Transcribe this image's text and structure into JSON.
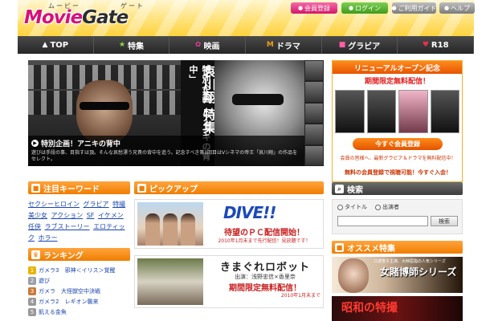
{
  "header": {
    "logo_main": "Movie",
    "logo_gate": "Gate",
    "logo_ruby1": "ムービー",
    "logo_ruby2": "ゲート",
    "buttons": {
      "register": "会員登録",
      "login": "ログイン",
      "guide": "ご利用ガイド",
      "help": "ヘルプ"
    }
  },
  "nav": {
    "items": [
      {
        "icon": "home-icon",
        "label": "TOP"
      },
      {
        "icon": "star-icon",
        "label": "特集"
      },
      {
        "icon": "film-icon",
        "label": "映画"
      },
      {
        "icon": "m-icon",
        "label": "ドラマ"
      },
      {
        "icon": "camera-icon",
        "label": "グラビア"
      },
      {
        "icon": "r18-icon",
        "label": "R18"
      }
    ]
  },
  "hero": {
    "vertical_title": "特別企画「アニキの背中」",
    "vertical_name": "哀川翔 特集",
    "caption_title": "特別企画！アニキの背中",
    "caption_desc": "遊びは手段の事、目指すは頂。そんな哀愁漂う兄貴の背中を追う。記念すべき第1回目はVシネマの帝王「哀川翔」の作品をセレクト。"
  },
  "promo": {
    "head1": "リニューアルオープン記念",
    "head2": "期間限定無料配信！",
    "button": "今すぐ会員登録",
    "note": "会員の皆様へ、最新グラビア＆ドラマを無料配信中！",
    "note2": "無料の会員登録で視聴可能！今すぐ入会！"
  },
  "keywords": {
    "title": "注目キーワード",
    "items": [
      "セクシーヒロイン",
      "グラビア",
      "特撮",
      "美少女",
      "アクション",
      "SF",
      "イケメン",
      "任侠",
      "ラブストーリー",
      "エロティック",
      "ホラー"
    ]
  },
  "ranking": {
    "title": "ランキング",
    "items": [
      {
        "n": "1",
        "label": "ガメラ3　邪神＜イリス＞覚醒"
      },
      {
        "n": "2",
        "label": "遊び"
      },
      {
        "n": "3",
        "label": "ガメラ　大怪獣空中決戦"
      },
      {
        "n": "4",
        "label": "ガメラ2　レギオン襲来"
      },
      {
        "n": "5",
        "label": "飢える金魚"
      }
    ]
  },
  "pickup": {
    "title": "ピックアップ",
    "item1": {
      "logo": "DIVE!!",
      "headline": "待望のＰＣ配信開始！",
      "sub": "2010年1月末まで先行配信！見放題です！"
    },
    "item2": {
      "title": "きまぐれロボット",
      "cast": "出演：浅野忠信×香里奈",
      "headline": "期間限定無料配信！",
      "until": "2010年1月末まで"
    }
  },
  "search": {
    "title": "検索",
    "option1": "タイトル",
    "option2": "出演者",
    "placeholder": "",
    "button": "検索"
  },
  "osusume": {
    "title": "オススメ特集",
    "item1_title": "女賭博師シリーズ",
    "item1_sub": "江波杏子主演、大映屈指の人気シリーズ",
    "item2_title": "昭和の特撮"
  },
  "colors": {
    "accent_orange": "#f07d00",
    "nav_bg": "#333333",
    "header_yellow": "#ffd23d",
    "link_blue": "#1a45b0",
    "alert_red": "#c81e1e"
  }
}
